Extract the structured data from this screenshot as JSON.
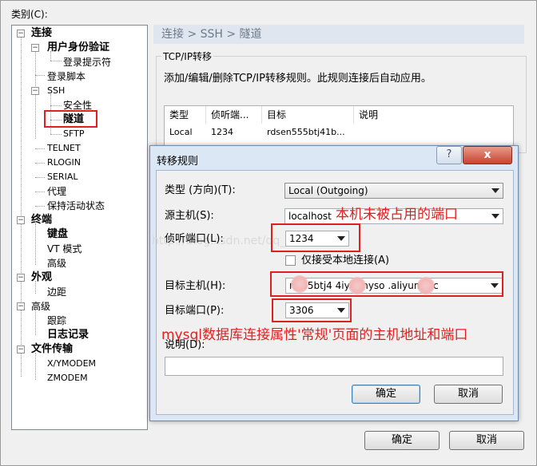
{
  "outer": {
    "category_label": "类别(C):",
    "ok_label": "确定",
    "cancel_label": "取消"
  },
  "tree": {
    "connection": "连接",
    "auth": "用户身份验证",
    "login_prompt": "登录提示符",
    "login_script": "登录脚本",
    "ssh": "SSH",
    "security": "安全性",
    "tunnel": "隧道",
    "sftp": "SFTP",
    "telnet": "TELNET",
    "rlogin": "RLOGIN",
    "serial": "SERIAL",
    "proxy": "代理",
    "keepalive": "保持活动状态",
    "terminal": "终端",
    "keyboard": "键盘",
    "vt_mode": "VT 模式",
    "advanced_term": "高级",
    "appearance": "外观",
    "margin": "边距",
    "advanced": "高级",
    "trace": "跟踪",
    "logging": "日志记录",
    "file_transfer": "文件传输",
    "xymodem": "X/YMODEM",
    "zmodem": "ZMODEM"
  },
  "panel": {
    "breadcrumb": "连接 > SSH > 隧道",
    "group_title": "TCP/IP转移",
    "description": "添加/编辑/删除TCP/IP转移规则。此规则连接后自动应用。",
    "columns": [
      "类型",
      "侦听端...",
      "目标",
      "说明"
    ],
    "row": [
      "Local",
      "1234",
      "rdsen555btj41b...",
      ""
    ]
  },
  "dialog": {
    "title": "转移规则",
    "help_icon": "?",
    "close_icon": "x",
    "type_label": "类型 (方向)(T):",
    "type_value": "Local (Outgoing)",
    "source_host_label": "源主机(S):",
    "source_host_value": "localhost",
    "listen_port_label": "侦听端口(L):",
    "listen_port_value": "1234",
    "local_only_label": "仅接受本地连接(A)",
    "target_host_label": "目标主机(H):",
    "target_host_value": "n555btj4   4iy3.myso   .aliyuncs.c",
    "target_port_label": "目标端口(P):",
    "target_port_value": "3306",
    "description_label": "说明(D):",
    "description_value": "",
    "ok_label": "确定",
    "cancel_label": "取消"
  },
  "annotations": {
    "unused_port": "本机未被占用的端口",
    "mysql_note": "mysql数据库连接属性'常规'页面的主机地址和端口",
    "watermark": "http://blog.csdn.net/qq_15158911"
  },
  "colors": {
    "annotation_red": "#e0201f",
    "dialog_frame": "#dbe7f4",
    "close_button": "#c7442f"
  }
}
